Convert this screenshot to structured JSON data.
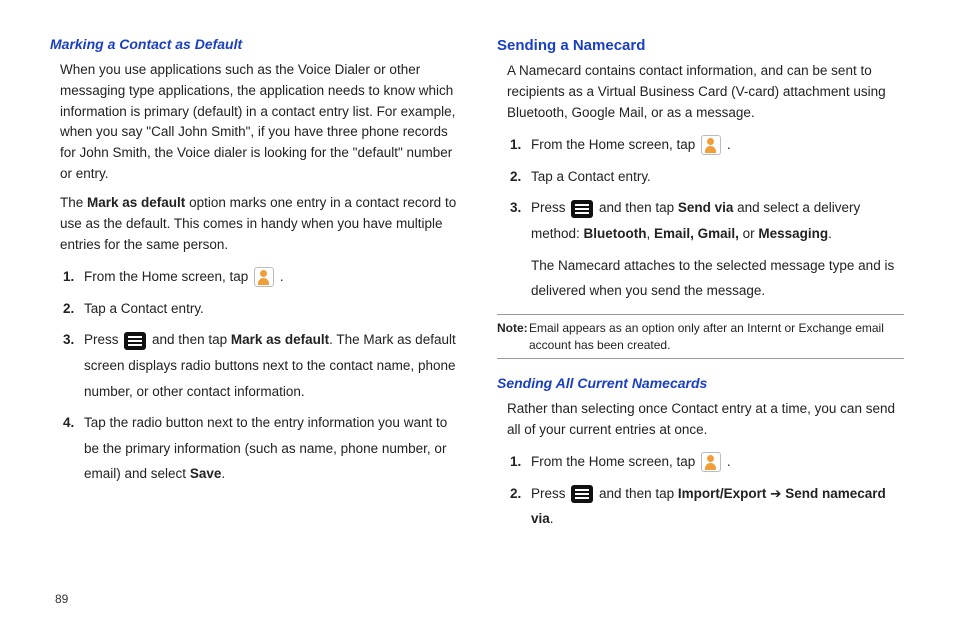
{
  "page_number": "89",
  "left": {
    "heading": "Marking a Contact as Default",
    "para1": "When you use applications such as the Voice Dialer or other messaging type applications, the application needs to know which information is primary (default) in a contact entry list. For example, when you say \"Call John Smith\", if you have three phone records for John Smith, the Voice dialer is looking for the \"default\" number or entry.",
    "para2_pre": "The ",
    "para2_b": "Mark as default",
    "para2_post": " option marks one entry in a contact record to use as the default. This comes in handy when you have multiple entries for the same person.",
    "step1_pre": "From the Home screen, tap ",
    "step1_post": " .",
    "step2": "Tap a Contact entry.",
    "step3_pre": "Press ",
    "step3_mid": " and then tap ",
    "step3_b": "Mark as default",
    "step3_post": ". The Mark as default screen displays radio buttons next to the contact name, phone number, or other contact information.",
    "step4_pre": "Tap the radio button next to the entry information you want to be the primary information (such as name, phone number, or email) and select ",
    "step4_b": "Save",
    "step4_post": "."
  },
  "right": {
    "heading1": "Sending a Namecard",
    "para1": "A Namecard contains contact information, and can be sent to recipients as a Virtual Business Card (V-card) attachment using Bluetooth, Google Mail, or as a message.",
    "step1_pre": "From the Home screen, tap ",
    "step1_post": " .",
    "step2": "Tap a Contact entry.",
    "step3_pre": "Press ",
    "step3_mid": " and then tap ",
    "step3_b1": "Send via",
    "step3_mid2": " and select a delivery method: ",
    "step3_b2": "Bluetooth",
    "step3_b3": "Email, Gmail,",
    "step3_or": " or ",
    "step3_b4": "Messaging",
    "step3_post": ".",
    "step3_p2": "The Namecard attaches to the selected message type and is delivered when you send the message.",
    "note_label": "Note:",
    "note_body": " Email appears as an option only after an Internt or Exchange email account has been created.",
    "heading2": "Sending All Current Namecards",
    "para2": "Rather than selecting once Contact entry at a time, you can send all of your current entries at once.",
    "s2_step1_pre": "From the Home screen, tap ",
    "s2_step1_post": " .",
    "s2_step2_pre": "Press ",
    "s2_step2_mid": " and then tap ",
    "s2_step2_b1": "Import/Export",
    "s2_step2_arrow": " ➔ ",
    "s2_step2_b2": "Send namecard via",
    "s2_step2_post": "."
  }
}
